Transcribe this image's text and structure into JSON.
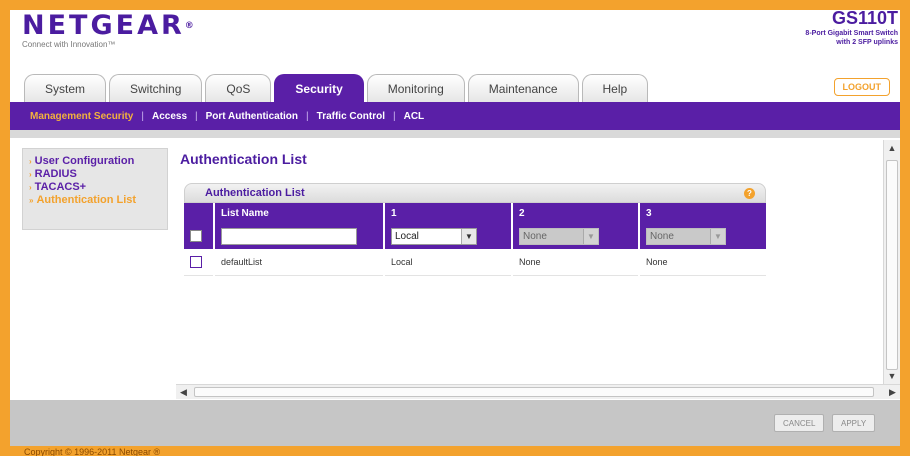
{
  "header": {
    "brand": "NETGEAR",
    "brand_mark": "®",
    "tagline": "Connect with Innovation™",
    "model": "GS110T",
    "model_desc_1": "8-Port Gigabit Smart Switch",
    "model_desc_2": "with 2 SFP uplinks",
    "logout": "LOGOUT"
  },
  "tabs": [
    {
      "label": "System"
    },
    {
      "label": "Switching"
    },
    {
      "label": "QoS"
    },
    {
      "label": "Security"
    },
    {
      "label": "Monitoring"
    },
    {
      "label": "Maintenance"
    },
    {
      "label": "Help"
    }
  ],
  "subnav": [
    {
      "label": "Management Security"
    },
    {
      "label": "Access"
    },
    {
      "label": "Port Authentication"
    },
    {
      "label": "Traffic Control"
    },
    {
      "label": "ACL"
    }
  ],
  "leftmenu": [
    {
      "label": "User Configuration"
    },
    {
      "label": "RADIUS"
    },
    {
      "label": "TACACS+"
    },
    {
      "label": "Authentication List"
    }
  ],
  "content": {
    "title": "Authentication List",
    "panel_title": "Authentication List",
    "help": "?"
  },
  "table": {
    "headers": [
      "",
      "List Name",
      "1",
      "2",
      "3"
    ],
    "edit_row": {
      "list_name": "",
      "m1": "Local",
      "m2": "None",
      "m3": "None"
    },
    "rows": [
      {
        "name": "defaultList",
        "m1": "Local",
        "m2": "None",
        "m3": "None"
      }
    ]
  },
  "buttons": {
    "cancel": "CANCEL",
    "apply": "APPLY"
  },
  "footer": "Copyright © 1996-2011 Netgear ®",
  "colors": {
    "brand_purple": "#5a1fa7",
    "accent_orange": "#f3a22d"
  }
}
